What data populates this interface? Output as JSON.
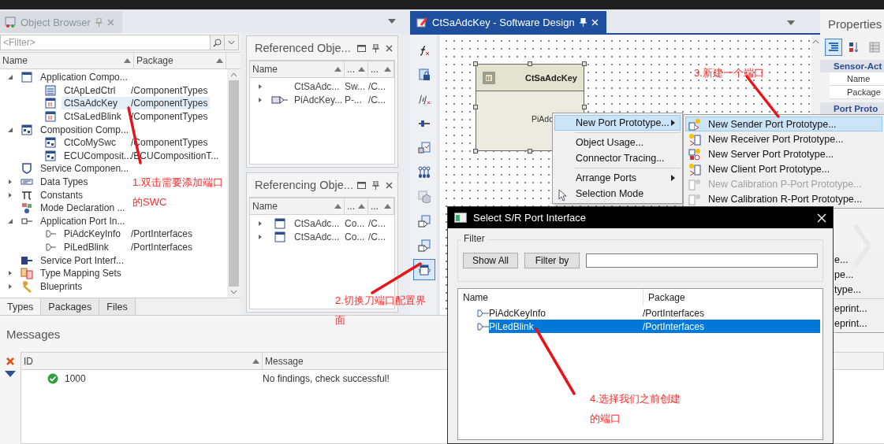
{
  "object_browser": {
    "title": "Object Browser",
    "filter": {
      "placeholder": "<Filter>"
    },
    "columns": [
      "Name",
      "Package"
    ],
    "tree": [
      {
        "label": "Application Compo...",
        "kind": "application",
        "expanded": true,
        "selected": false,
        "children": [
          {
            "label": "CtApLedCtrl",
            "package": "/ComponentTypes",
            "kind": "app-swc",
            "selected": false
          },
          {
            "label": "CtSaAdcKey",
            "package": "/ComponentTypes",
            "kind": "sensor-swc",
            "selected": true
          },
          {
            "label": "CtSaLedBlink",
            "package": "/ComponentTypes",
            "kind": "sensor-swc",
            "selected": false
          }
        ]
      },
      {
        "label": "Composition Comp...",
        "kind": "composition",
        "expanded": true,
        "selected": false,
        "children": [
          {
            "label": "CtCoMySwc",
            "package": "/ComponentTypes",
            "kind": "composition",
            "selected": false
          },
          {
            "label": "ECUComposit...",
            "package": "/ECUCompositionT...",
            "kind": "composition",
            "selected": false
          }
        ]
      },
      {
        "label": "Service Componen...",
        "kind": "service",
        "selected": false
      },
      {
        "label": "Data Types",
        "kind": "types",
        "expanded": false,
        "selected": false
      },
      {
        "label": "Constants",
        "kind": "constants",
        "expanded": false,
        "selected": false
      },
      {
        "label": "Mode Declaration ...",
        "kind": "mode",
        "selected": false
      },
      {
        "label": "Application Port In...",
        "kind": "port-group",
        "expanded": true,
        "selected": false,
        "children": [
          {
            "label": "PiAdcKeyInfo",
            "package": "/PortInterfaces",
            "kind": "port",
            "selected": false
          },
          {
            "label": "PiLedBlink",
            "package": "/PortInterfaces",
            "kind": "port",
            "selected": false
          }
        ]
      },
      {
        "label": "Service Port Interf...",
        "kind": "service-port",
        "selected": false
      },
      {
        "label": "Type Mapping Sets",
        "kind": "mapping",
        "expanded": false,
        "selected": false
      },
      {
        "label": "Blueprints",
        "kind": "blueprint",
        "expanded": false,
        "selected": false
      }
    ],
    "tabs": [
      {
        "label": "Types",
        "selected": true
      },
      {
        "label": "Packages",
        "selected": false
      },
      {
        "label": "Files",
        "selected": false
      }
    ]
  },
  "referenced": {
    "title": "Referenced Obje...",
    "columns": [
      "Name",
      "...",
      "..."
    ],
    "rows": [
      {
        "kind": "blank",
        "cells": [
          "CtSaAdc...",
          "Sw...",
          "/C..."
        ]
      },
      {
        "kind": "port",
        "cells": [
          "PiAdcKey...",
          "P-...",
          "/C..."
        ]
      }
    ]
  },
  "referencing": {
    "title": "Referencing Obje...",
    "columns": [
      "Name",
      "...",
      "..."
    ],
    "rows": [
      {
        "kind": "application",
        "cells": [
          "CtSaAdc...",
          "Co...",
          "/C..."
        ]
      },
      {
        "kind": "application",
        "cells": [
          "CtSaAdc...",
          "Co...",
          "/C..."
        ]
      }
    ]
  },
  "design": {
    "tab": {
      "title": "CtSaAdcKey - Software Design",
      "selected": true
    },
    "toolbar": [
      {
        "kind": "function",
        "selected": false
      },
      {
        "kind": "lock",
        "selected": false
      },
      {
        "kind": "function-pair",
        "selected": false
      },
      {
        "kind": "slider",
        "selected": false
      },
      {
        "kind": "check-doc",
        "selected": false
      },
      {
        "kind": "chain",
        "selected": false
      },
      {
        "kind": "cube",
        "selected": false
      },
      {
        "kind": "port-doc",
        "selected": false
      },
      {
        "kind": "port-doc",
        "selected": false
      },
      {
        "kind": "port-component",
        "selected": true
      }
    ],
    "component": {
      "name": "CtSaAdcKey",
      "port": "PiAdc"
    }
  },
  "properties": {
    "title": "Properties",
    "section": "Sensor-Act",
    "fields": [
      "Name",
      "Package"
    ],
    "section_2": "Port Proto"
  },
  "context_menu": [
    {
      "kind": "item",
      "label": "New Port Prototype...",
      "submenu": true,
      "selected": true
    },
    {
      "kind": "separator"
    },
    {
      "kind": "item",
      "label": "Object Usage...",
      "submenu": false,
      "selected": false
    },
    {
      "kind": "item",
      "label": "Connector Tracing...",
      "submenu": false,
      "selected": false
    },
    {
      "kind": "separator"
    },
    {
      "kind": "item",
      "label": "Arrange Ports",
      "submenu": true,
      "selected": false
    },
    {
      "kind": "tool",
      "label": "Selection Mode",
      "submenu": false,
      "selected": false
    }
  ],
  "submenu": [
    {
      "kind": "sender",
      "label": "New Sender Port Prototype...",
      "selected": true,
      "disabled": false
    },
    {
      "kind": "receiver",
      "label": "New Receiver Port Prototype...",
      "selected": false,
      "disabled": false
    },
    {
      "kind": "server",
      "label": "New Server Port Prototype...",
      "selected": false,
      "disabled": false
    },
    {
      "kind": "client",
      "label": "New Client Port Prototype...",
      "selected": false,
      "disabled": false
    },
    {
      "kind": "calibration",
      "label": "New Calibration P-Port Prototype...",
      "selected": false,
      "disabled": true
    },
    {
      "kind": "calibration",
      "label": "New Calibration R-Port Prototype...",
      "selected": false,
      "disabled": false
    }
  ],
  "submenu_overflow": [
    {
      "kind": "text",
      "label": "e..."
    },
    {
      "kind": "text",
      "label": "pe..."
    },
    {
      "kind": "text",
      "label": "type..."
    },
    {
      "kind": "separator"
    },
    {
      "kind": "text",
      "label": "eprint..."
    },
    {
      "kind": "text",
      "label": "eprint..."
    }
  ],
  "dialog": {
    "title": "Select S/R Port Interface",
    "filter_label": "Filter",
    "buttons": [
      "Show All",
      "Filter by"
    ],
    "columns": [
      "Name",
      "Package"
    ],
    "rows": [
      {
        "name": "PiAdcKeyInfo",
        "package": "/PortInterfaces",
        "selected": false
      },
      {
        "name": "PiLedBlink",
        "package": "/PortInterfaces",
        "selected": true
      }
    ]
  },
  "messages": {
    "title": "Messages",
    "columns": [
      "ID",
      "Message"
    ],
    "rows": [
      {
        "kind": "ok",
        "id": "1000",
        "message": "No findings, check successful!"
      }
    ]
  },
  "annotations": [
    "1.双击需要添加端口的SWC",
    "2.切换刀端口配置界面",
    "3.新建一个端口",
    "4.选择我们之前创建的端口"
  ]
}
